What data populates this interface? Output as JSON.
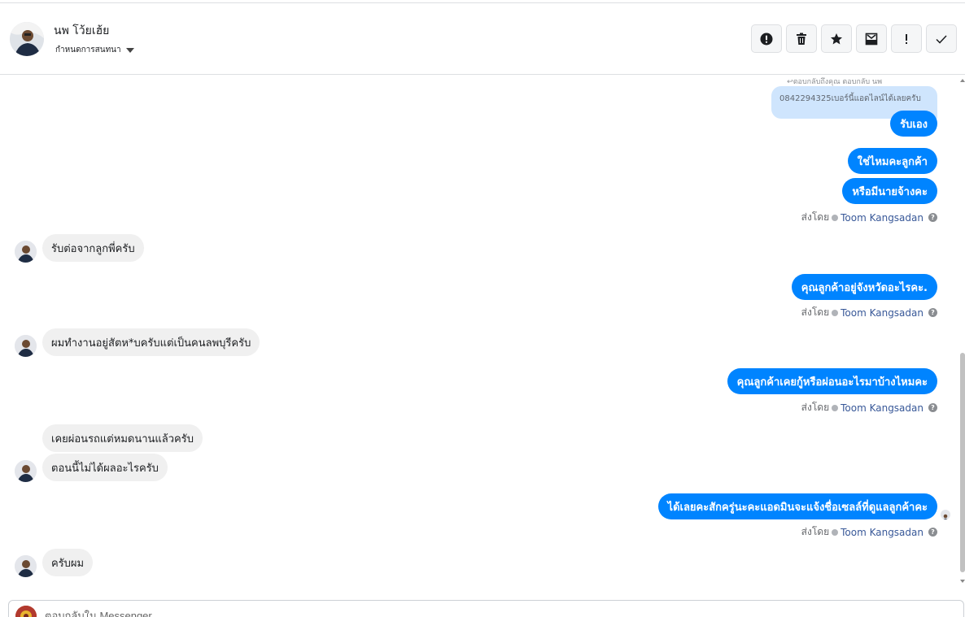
{
  "header": {
    "contact_name": "นพ โว้ยเฮ้ย",
    "settings_label": "กำหนดการสนทนา",
    "actions": [
      {
        "name": "mark-spam",
        "icon": "alert-circle-icon"
      },
      {
        "name": "delete",
        "icon": "trash-icon"
      },
      {
        "name": "star",
        "icon": "star-icon"
      },
      {
        "name": "archive",
        "icon": "archive-icon"
      },
      {
        "name": "follow-up",
        "icon": "exclamation-icon"
      },
      {
        "name": "done",
        "icon": "check-icon"
      }
    ]
  },
  "chat": {
    "reply_caption": "↩ตอบกลับถึงคุณ ตอบกลับ นพ",
    "reply_quote": "0842294325เบอร์นี้แอดไลน์ได้เลยครับ",
    "messages": [
      {
        "dir": "out",
        "text": "รับเอง"
      },
      {
        "dir": "out",
        "text": "ใช่ไหมคะลูกค้า"
      },
      {
        "dir": "out",
        "text": "หรือมีนายจ้างคะ"
      },
      {
        "dir": "in",
        "text": "รับต่อจากลูกพี่ครับ"
      },
      {
        "dir": "out",
        "text": "คุณลูกค้าอยู่จังหวัดอะไรคะ."
      },
      {
        "dir": "in",
        "text": "ผมทำงานอยู่สัตห*บครับแต่เป็นคนลพบุรีครับ"
      },
      {
        "dir": "out",
        "text": "คุณลูกค้าเคยกู้หรือผ่อนอะไรมาบ้างไหมคะ"
      },
      {
        "dir": "in",
        "text": "เคยผ่อนรถแต่หมดนานแล้วครับ"
      },
      {
        "dir": "in",
        "text": "ตอนนี้ไม่ได้ผลอะไรครับ"
      },
      {
        "dir": "out",
        "text": "ได้เลยคะสักครู่นะคะแอดมินจะแจ้งชื่อเซลล์ที่ดูแลลูกค้าคะ"
      },
      {
        "dir": "in",
        "text": "ครับผม"
      }
    ],
    "sent_by_prefix": "ส่งโดย",
    "sent_by_name": "Toom Kangsadan",
    "help_glyph": "?"
  },
  "composer": {
    "placeholder": "ตอบกลับใน Messenger"
  }
}
